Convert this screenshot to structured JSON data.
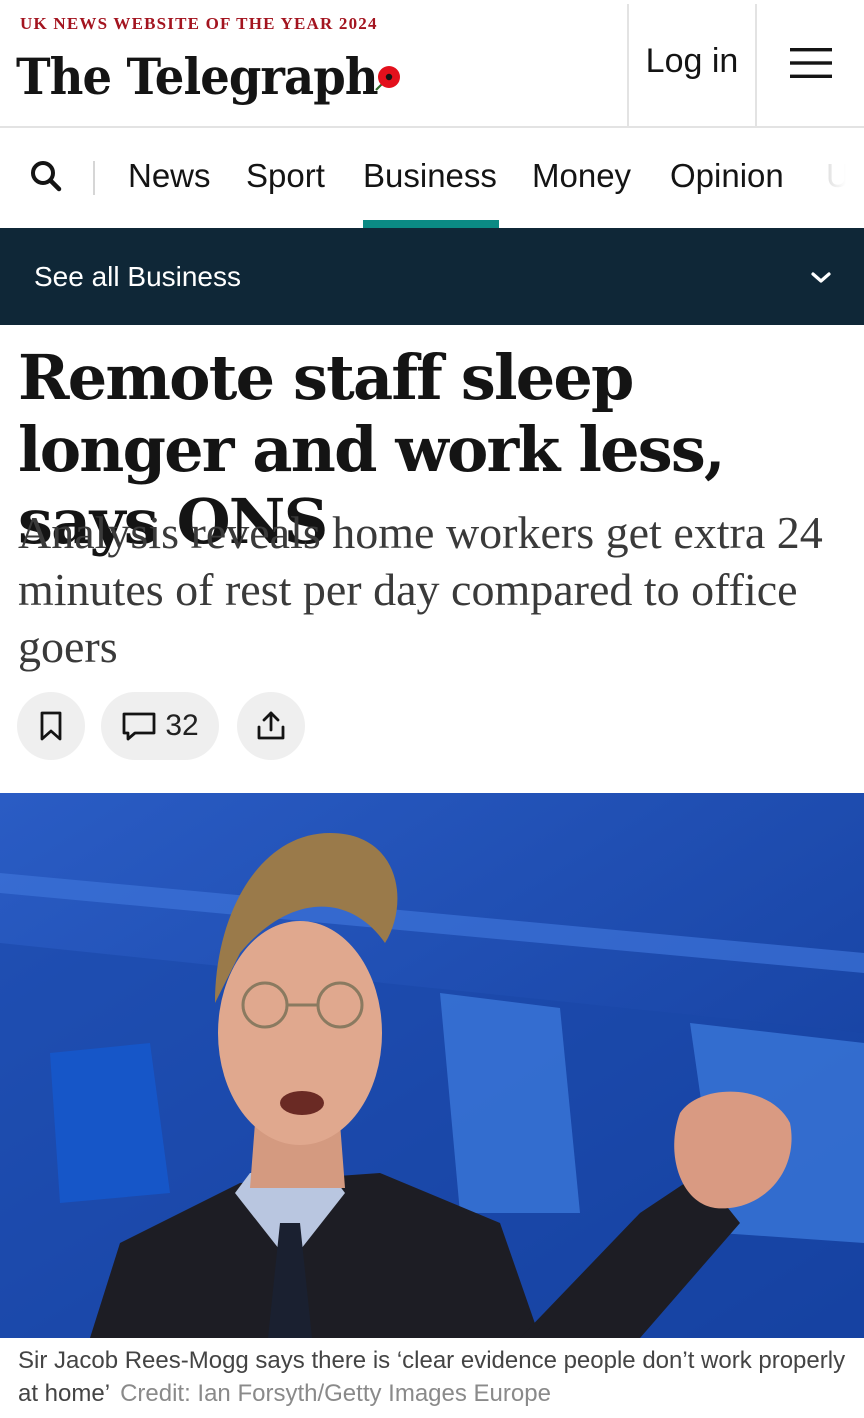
{
  "header": {
    "award": "UK NEWS WEBSITE OF THE YEAR 2024",
    "logo": "The Telegraph",
    "login_label": "Log in",
    "menu_icon": "hamburger-menu-icon",
    "brand_red": "#a3141f"
  },
  "nav": {
    "search_icon": "search-icon",
    "items": [
      "News",
      "Sport",
      "Business",
      "Money",
      "Opinion",
      "U"
    ],
    "active": "Business",
    "accent": "#0b8a84"
  },
  "section": {
    "label": "See all Business",
    "background": "#0f2737"
  },
  "article": {
    "headline": "Remote staff sleep longer and work less, says ONS",
    "standfirst": "Analysis reveals home workers get extra 24 minutes of rest per day compared to office goers",
    "comment_count": "32"
  },
  "image": {
    "caption": "Sir Jacob Rees-Mogg says there is ‘clear evidence people don’t work properly at home’",
    "credit": "Credit: Ian Forsyth/Getty Images Europe"
  }
}
